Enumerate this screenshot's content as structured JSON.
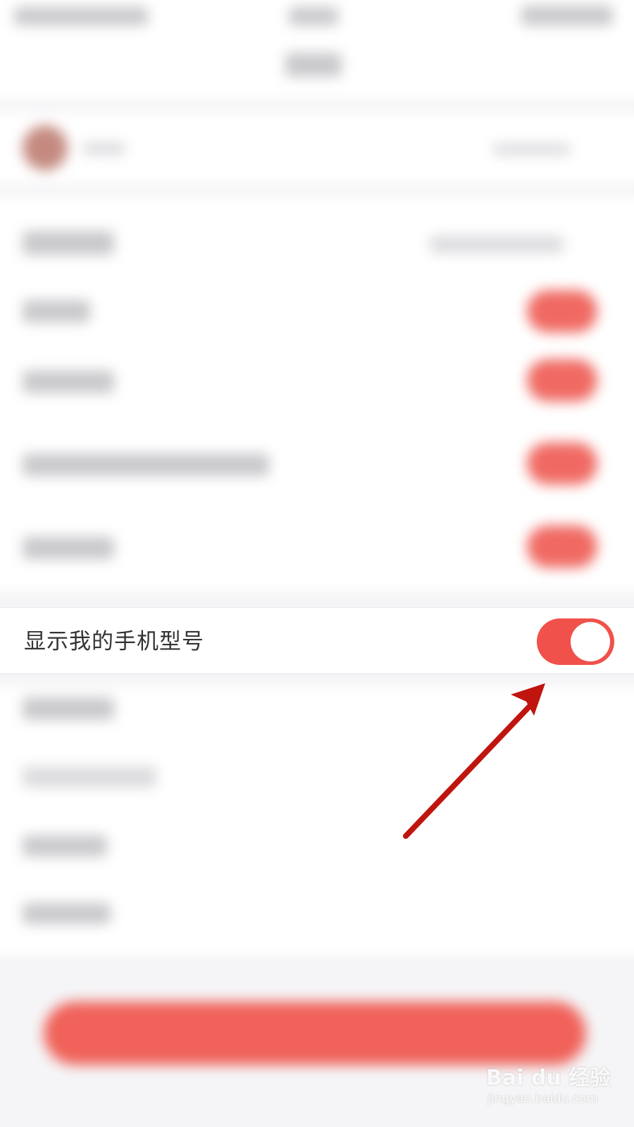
{
  "setting": {
    "label": "显示我的手机型号",
    "enabled": true
  },
  "watermark": {
    "brand": "Bai du 经验",
    "url": "jingyan.baidu.com"
  },
  "colors": {
    "accent": "#f0514b",
    "arrow": "#c0150e",
    "row_bg": "#ffffff",
    "page_bg": "#f5f5f7",
    "text": "#333333"
  },
  "icons": {
    "annotation": "arrow-icon",
    "watermark": "paw-icon"
  }
}
